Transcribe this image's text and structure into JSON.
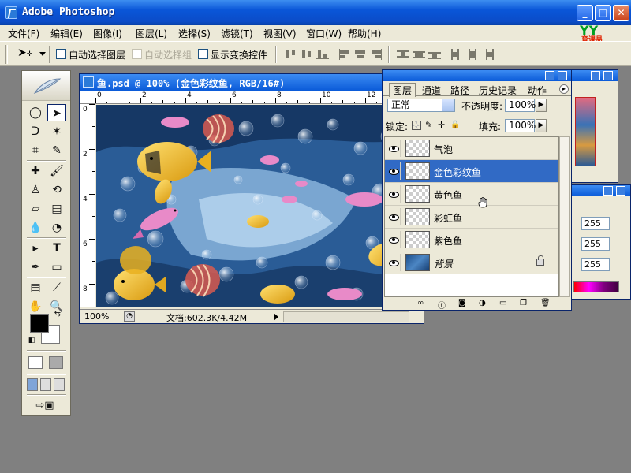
{
  "window": {
    "title": "Adobe Photoshop"
  },
  "menu": [
    "文件(F)",
    "编辑(E)",
    "图像(I)",
    "图层(L)",
    "选择(S)",
    "滤镜(T)",
    "视图(V)",
    "窗口(W)",
    "帮助(H)"
  ],
  "logo": {
    "letters": "YY",
    "text": "育课易"
  },
  "options": {
    "auto_select_layer": "自动选择图层",
    "auto_select_group": "自动选择组",
    "show_transform": "显示变换控件"
  },
  "document": {
    "title": "鱼.psd @ 100% (金色彩纹鱼, RGB/16#)",
    "zoom": "100%",
    "info": "文档:602.3K/4.42M",
    "ruler_h": [
      "0",
      "2",
      "4",
      "6",
      "8",
      "10",
      "12"
    ],
    "ruler_v": [
      "0",
      "2",
      "4",
      "6",
      "8"
    ]
  },
  "layers_panel": {
    "tabs": [
      "图层",
      "通道",
      "路径",
      "历史记录",
      "动作"
    ],
    "blend_mode": "正常",
    "opacity_label": "不透明度:",
    "opacity": "100%",
    "lock_label": "锁定:",
    "fill_label": "填充:",
    "fill": "100%",
    "layers": [
      {
        "name": "气泡",
        "selected": false
      },
      {
        "name": "金色彩纹鱼",
        "selected": true
      },
      {
        "name": "黄色鱼",
        "selected": false
      },
      {
        "name": "彩虹鱼",
        "selected": false
      },
      {
        "name": "紫色鱼",
        "selected": false
      },
      {
        "name": "背景",
        "selected": false,
        "locked": true
      }
    ]
  },
  "color_panel": {
    "values": [
      "255",
      "255",
      "255"
    ]
  },
  "colors": {
    "title_blue": "#0a56d8",
    "selected_layer": "#316ac5",
    "chrome": "#ece9d8"
  }
}
